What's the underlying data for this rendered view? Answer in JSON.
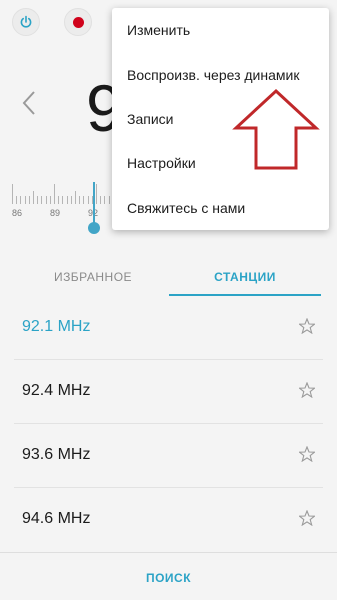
{
  "frequency": {
    "big_text": "9"
  },
  "dial": {
    "labels": [
      "86",
      "89",
      "92"
    ]
  },
  "tabs": [
    {
      "label": "ИЗБРАННОЕ",
      "active": false
    },
    {
      "label": "СТАНЦИИ",
      "active": true
    }
  ],
  "stations": [
    {
      "label": "92.1 MHz",
      "active": true
    },
    {
      "label": "92.4 MHz",
      "active": false
    },
    {
      "label": "93.6 MHz",
      "active": false
    },
    {
      "label": "94.6 MHz",
      "active": false
    }
  ],
  "search": {
    "label": "ПОИСК"
  },
  "menu": {
    "items": [
      "Изменить",
      "Воспроизв. через динамик",
      "Записи",
      "Настройки",
      "Свяжитесь с нами"
    ]
  },
  "colors": {
    "accent": "#2ba3c6",
    "record": "#d0021b",
    "arrow": "#c0282a"
  }
}
